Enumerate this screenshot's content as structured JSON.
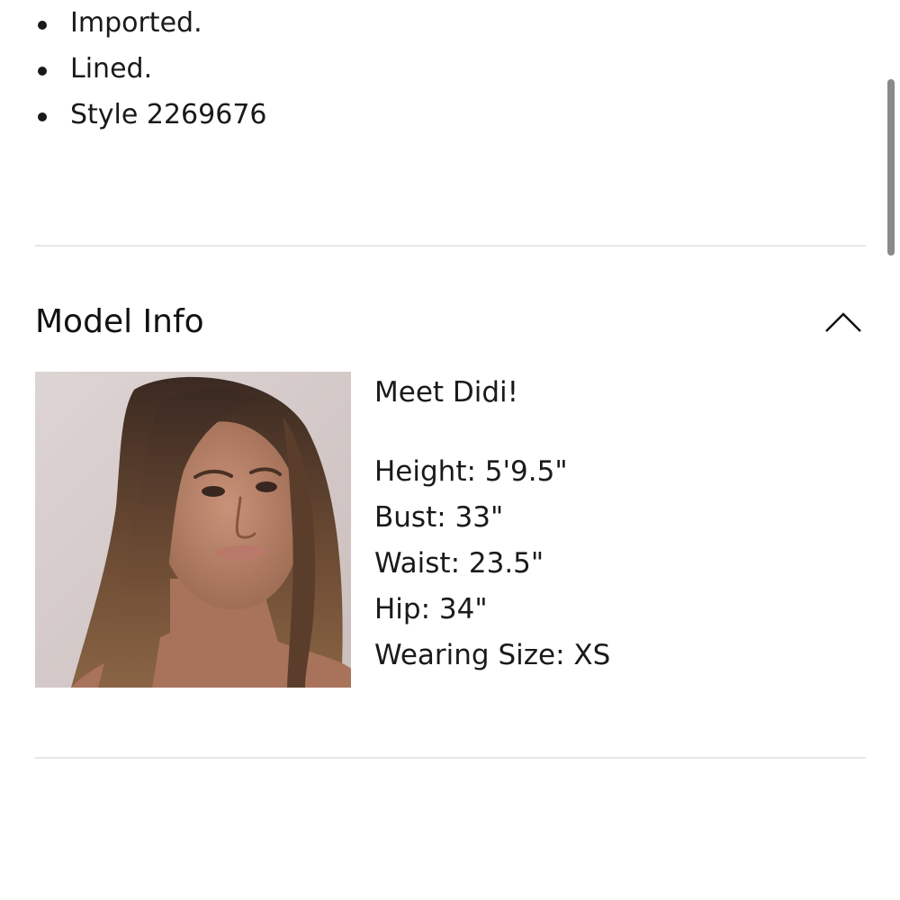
{
  "details_list": [
    {
      "text": "Imported."
    },
    {
      "text": "Lined."
    },
    {
      "text": "Style 2269676"
    }
  ],
  "model_section": {
    "title": "Model Info",
    "toggle_icon": "chevron-up-icon",
    "intro": "Meet Didi!",
    "measurements": [
      {
        "text": "Height: 5'9.5\""
      },
      {
        "text": "Bust: 33\""
      },
      {
        "text": "Waist: 23.5\""
      },
      {
        "text": "Hip: 34\""
      },
      {
        "text": "Wearing Size: XS"
      }
    ]
  },
  "colors": {
    "text": "#1a1a1a",
    "divider": "#e6e6e6",
    "scrollbar": "#8a8a8a"
  }
}
